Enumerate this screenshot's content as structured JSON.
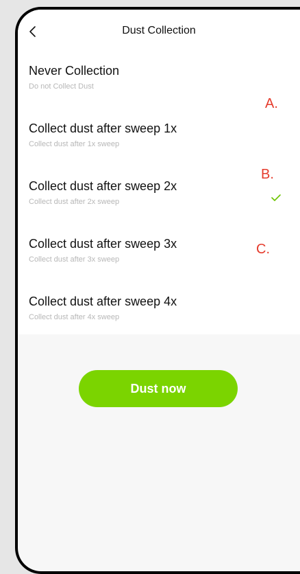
{
  "header": {
    "title": "Dust Collection"
  },
  "options": [
    {
      "title": "Never Collection",
      "subtitle": "Do not Collect Dust"
    },
    {
      "title": "Collect dust after sweep 1x",
      "subtitle": "Collect dust after 1x sweep"
    },
    {
      "title": "Collect dust after sweep 2x",
      "subtitle": "Collect dust after 2x sweep",
      "selected": true
    },
    {
      "title": "Collect dust after sweep 3x",
      "subtitle": "Collect dust after 3x sweep"
    },
    {
      "title": "Collect dust after sweep 4x",
      "subtitle": "Collect dust after 4x sweep"
    }
  ],
  "annotations": {
    "a": "A.",
    "b": "B.",
    "c": "C."
  },
  "actions": {
    "dust_now": "Dust now"
  },
  "colors": {
    "accent_green": "#7bd400",
    "annotation_red": "#e53b2c",
    "check_green": "#6cc400"
  },
  "icons": {
    "back": "chevron-left-icon",
    "selected": "check-icon"
  }
}
